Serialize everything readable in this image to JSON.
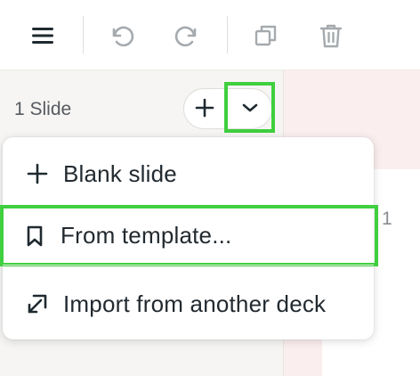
{
  "toolbar": {
    "icons": [
      "menu-icon",
      "undo-icon",
      "redo-icon",
      "duplicate-icon",
      "trash-icon"
    ]
  },
  "sidebar": {
    "slide_count": "1 Slide",
    "add_icon": "plus-icon",
    "dropdown_icon": "chevron-down-icon"
  },
  "canvas": {
    "slide_number": "1"
  },
  "menu": {
    "items": [
      {
        "label": "Blank slide",
        "icon": "plus-icon"
      },
      {
        "label": "From template...",
        "icon": "bookmark-icon"
      },
      {
        "label": "Import from another deck",
        "icon": "import-arrow-icon"
      }
    ]
  },
  "colors": {
    "highlight": "#3fcf3f",
    "sidebar_bg": "#f6f5f3",
    "canvas_bg": "#fbeeee",
    "text": "#222a30"
  }
}
